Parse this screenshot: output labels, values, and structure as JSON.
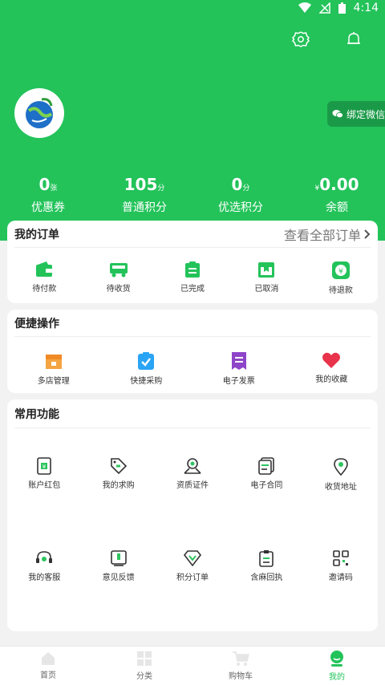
{
  "status_bar": {
    "time": "4:14"
  },
  "header": {
    "bind_wechat": "绑定微信"
  },
  "stats": [
    {
      "value": "0",
      "unit": "张",
      "label": "优惠券"
    },
    {
      "value": "105",
      "unit": "分",
      "label": "普通积分"
    },
    {
      "value": "0",
      "unit": "分",
      "label": "优选积分"
    },
    {
      "value": "0.00",
      "unit": "¥",
      "label": "余额"
    }
  ],
  "orders": {
    "title": "我的订单",
    "view_all": "查看全部订单",
    "items": [
      "待付款",
      "待收货",
      "已完成",
      "已取消",
      "待退款"
    ]
  },
  "quick": {
    "title": "便捷操作",
    "items": [
      "多店管理",
      "快捷采购",
      "电子发票",
      "我的收藏"
    ]
  },
  "common": {
    "title": "常用功能",
    "row1": [
      "账户红包",
      "我的求购",
      "资质证件",
      "电子合同",
      "收货地址"
    ],
    "row2": [
      "我的客服",
      "意见反馈",
      "积分订单",
      "含麻回执",
      "邀请码"
    ]
  },
  "tabbar": [
    "首页",
    "分类",
    "购物车",
    "我的"
  ],
  "colors": {
    "brand": "#23c35a",
    "wechat_btn": "#1a9a48"
  }
}
